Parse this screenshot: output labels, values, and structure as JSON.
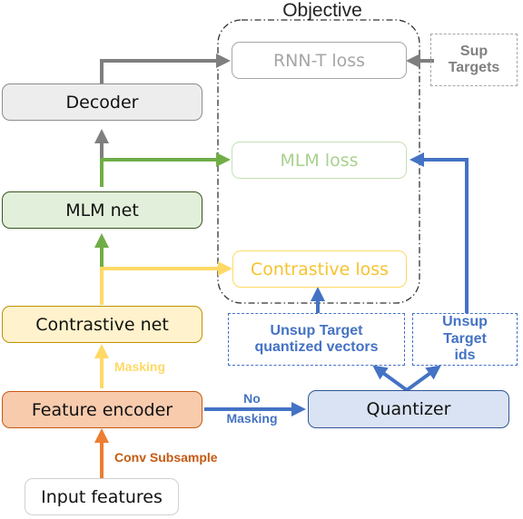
{
  "objective": {
    "title": "Objective"
  },
  "nodes": {
    "decoder": "Decoder",
    "mlm_net": "MLM net",
    "contrastive_net": "Contrastive net",
    "feature_encoder": "Feature encoder",
    "input_features": "Input features",
    "quantizer": "Quantizer",
    "rnnt_loss": "RNN-T loss",
    "mlm_loss": "MLM loss",
    "contrastive_loss": "Contrastive loss",
    "sup_targets": "Sup Targets",
    "unsup_vectors": "Unsup Target quantized vectors",
    "unsup_ids": "Unsup Target ids"
  },
  "edge_labels": {
    "masking": "Masking",
    "no_masking_1": "No",
    "no_masking_2": "Masking",
    "conv_subsample": "Conv Subsample"
  },
  "colors": {
    "gray": "#7f7f7f",
    "green": "#70ad47",
    "yellow": "#ffd966",
    "orange": "#ed7d31",
    "blue": "#4472c4"
  }
}
